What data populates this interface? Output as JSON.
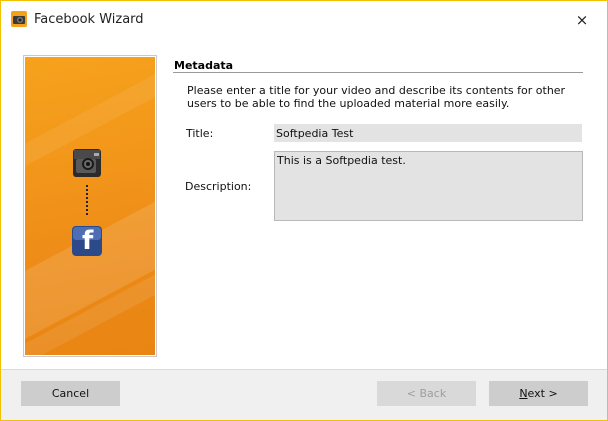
{
  "window": {
    "title": "Facebook Wizard",
    "close_glyph": "×",
    "app_icon": "camera-app-icon",
    "accent_color": "#f2c100"
  },
  "banner": {
    "colors": [
      "#f6a21c",
      "#e98512"
    ],
    "icons": [
      "video-camera-icon",
      "connector-dots-icon",
      "facebook-icon"
    ],
    "facebook_letter": "f"
  },
  "metadata": {
    "heading": "Metadata",
    "intro": "Please enter a title for your video and describe its contents for other users to be able to find the uploaded material more easily.",
    "title_label": "Title:",
    "title_value": "Softpedia Test",
    "description_label": "Description:",
    "description_value": "This is a Softpedia test."
  },
  "buttons": {
    "cancel": "Cancel",
    "back": "< Back",
    "back_enabled": false,
    "next_mnemonic": "N",
    "next_rest": "ext >"
  }
}
